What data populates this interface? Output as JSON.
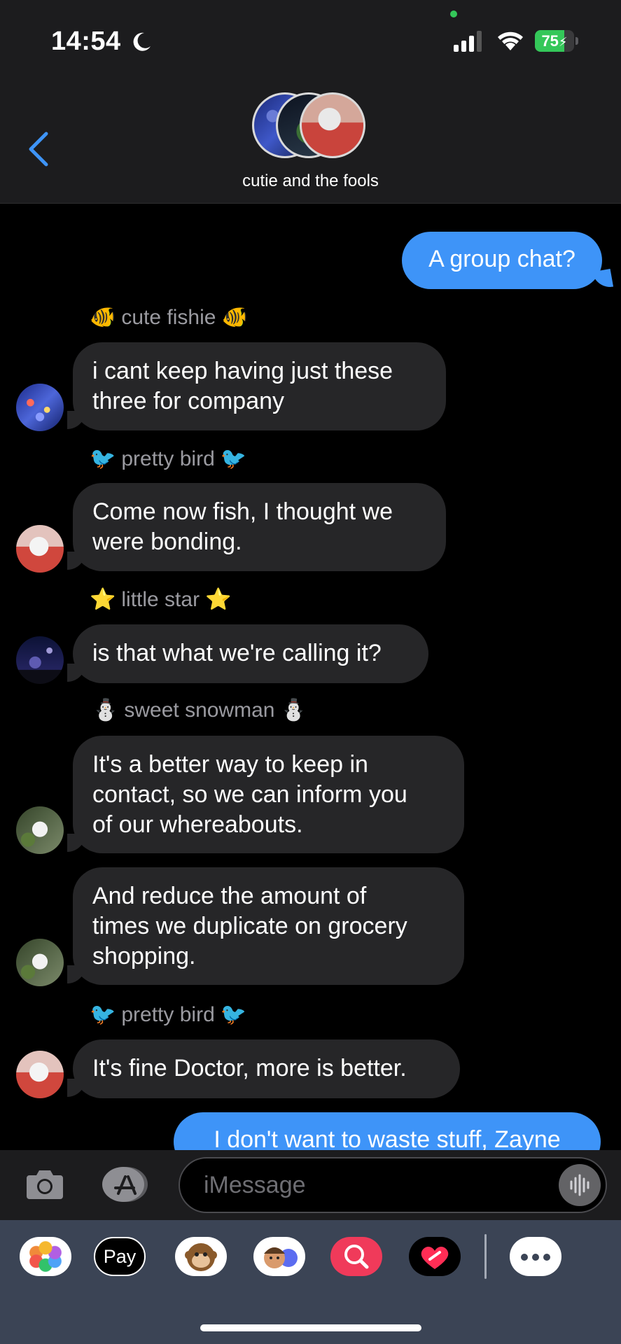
{
  "status_bar": {
    "time": "14:54",
    "battery_percent": "75",
    "battery_level": 0.75,
    "icons": [
      "moon-icon",
      "cellular-signal-icon",
      "wifi-icon",
      "battery-charging-icon"
    ]
  },
  "header": {
    "group_name": "cutie and the fools",
    "back_icon": "chevron-left-icon",
    "accent_color": "#3e94f8"
  },
  "messages": [
    {
      "type": "outgoing",
      "text": "A group chat?"
    },
    {
      "type": "sender",
      "emoji_left": "🐠",
      "name": "cute fishie",
      "emoji_right": "🐠"
    },
    {
      "type": "incoming",
      "line1": "i cant keep having just these",
      "line2": "three for company",
      "avatar": "fish"
    },
    {
      "type": "sender",
      "emoji_left": "🐦",
      "name": "pretty bird",
      "emoji_right": "🐦"
    },
    {
      "type": "incoming",
      "line1": "Come now fish, I thought we",
      "line2": "were bonding.",
      "avatar": "bird"
    },
    {
      "type": "sender",
      "emoji_left": "⭐",
      "name": "little star",
      "emoji_right": "⭐"
    },
    {
      "type": "incoming",
      "text": "is that what we're calling it?",
      "avatar": "star"
    },
    {
      "type": "sender",
      "emoji_left": "⛄",
      "name": "sweet snowman",
      "emoji_right": "⛄"
    },
    {
      "type": "incoming",
      "line1": "It's a better way to keep in",
      "line2": "contact, so we can inform you",
      "line3": "of our whereabouts.",
      "avatar": "snowman"
    },
    {
      "type": "incoming",
      "line1": "And reduce the amount of",
      "line2": "times we duplicate on grocery",
      "line3": "shopping.",
      "avatar": "snowman"
    },
    {
      "type": "sender",
      "emoji_left": "🐦",
      "name": "pretty bird",
      "emoji_right": "🐦"
    },
    {
      "type": "incoming",
      "text": "It's fine Doctor, more is better.",
      "avatar": "bird"
    },
    {
      "type": "outgoing",
      "text": "I don't want to waste stuff, Zayne"
    }
  ],
  "composer": {
    "placeholder": "iMessage",
    "camera_icon": "camera-icon",
    "apps_icon": "app-store-icon",
    "audio_icon": "audio-waveform-icon"
  },
  "app_drawer": {
    "apps": [
      "photos-app-icon",
      "apple-pay-icon",
      "animoji-icon",
      "memoji-icon",
      "image-search-icon",
      "digital-touch-icon",
      "more-apps-icon"
    ],
    "pay_label": "Pay"
  }
}
